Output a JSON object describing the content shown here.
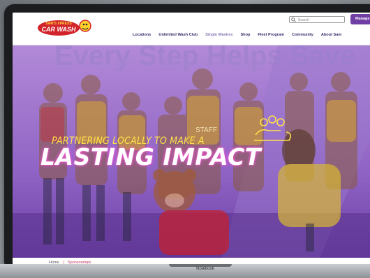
{
  "device": {
    "label": "Notebook"
  },
  "brand": {
    "line1": "SAM'S XPRESS",
    "line2": "CAR WASH"
  },
  "header": {
    "search_placeholder": "Search",
    "manage_button": "Manage Ac",
    "nav": [
      {
        "label": "Locations"
      },
      {
        "label": "Unlimited Wash Club"
      },
      {
        "label": "Single Washes"
      },
      {
        "label": "Shop"
      },
      {
        "label": "Fleet Program"
      },
      {
        "label": "Community"
      },
      {
        "label": "About Sam"
      }
    ]
  },
  "hero": {
    "tagline": "PARTNERING LOCALLY TO MAKE A",
    "headline": "LASTING IMPACT",
    "banner_text": "Every Step Helps Save",
    "staff_text": "STAFF"
  },
  "breadcrumb": {
    "home": "Home",
    "separator": "|",
    "current": "Sponsorships"
  },
  "colors": {
    "purple": "#6f3fa3",
    "overlay": "#7b4fb8",
    "headline_glow": "#ff55dd",
    "tagline": "#ffe14a",
    "brand_red": "#d2232a"
  }
}
